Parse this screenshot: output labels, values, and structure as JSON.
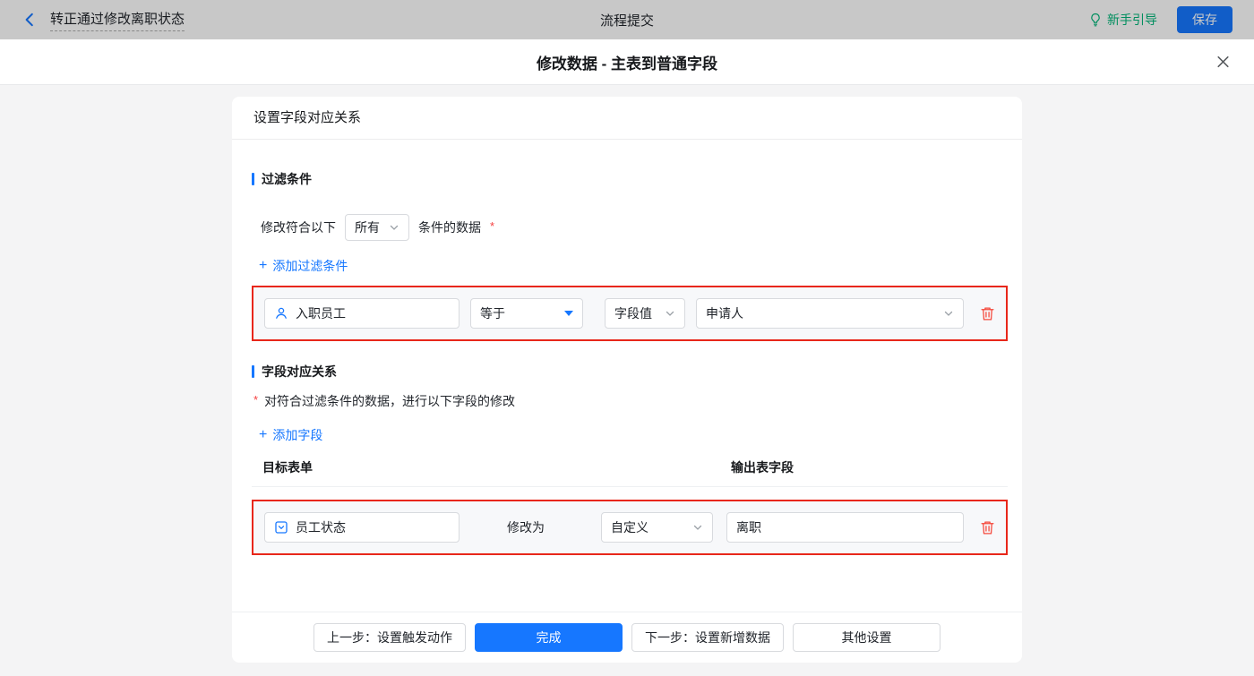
{
  "topbar": {
    "title": "转正通过修改离职状态",
    "center_title": "流程提交",
    "guide_label": "新手引导",
    "save_label": "保存"
  },
  "modal": {
    "title": "修改数据 - 主表到普通字段"
  },
  "panel": {
    "header_title": "设置字段对应关系",
    "filter": {
      "section_title": "过滤条件",
      "match_prefix": "修改符合以下",
      "match_value": "所有",
      "match_suffix": "条件的数据",
      "required_mark": "*",
      "add_icon": "+",
      "add_label": "添加过滤条件",
      "row": {
        "field_label": "入职员工",
        "operator_value": "等于",
        "value_type_value": "字段值",
        "value_value": "申请人"
      }
    },
    "mapping": {
      "section_title": "字段对应关系",
      "required_mark": "*",
      "description": "对符合过滤条件的数据，进行以下字段的修改",
      "add_icon": "+",
      "add_label": "添加字段",
      "columns": {
        "target": "目标表单",
        "output": "输出表字段"
      },
      "row": {
        "field_label": "员工状态",
        "action_label": "修改为",
        "mode_value": "自定义",
        "value_text": "离职"
      }
    },
    "footer": {
      "prev_label": "上一步：设置触发动作",
      "done_label": "完成",
      "next_label": "下一步：设置新增数据",
      "other_label": "其他设置"
    }
  },
  "icons": {
    "back": "chevron-left",
    "guide": "lightbulb",
    "close": "x",
    "condition_field": "user",
    "target_field": "select-box",
    "operator_caret": "caret-down-filled",
    "select_chevron": "chevron-down",
    "delete": "trash",
    "add": "plus"
  },
  "colors": {
    "accent_blue": "#1677ff",
    "annotation_red": "#e8271a",
    "delete_red": "#f5483b",
    "guide_green": "#00b578"
  }
}
